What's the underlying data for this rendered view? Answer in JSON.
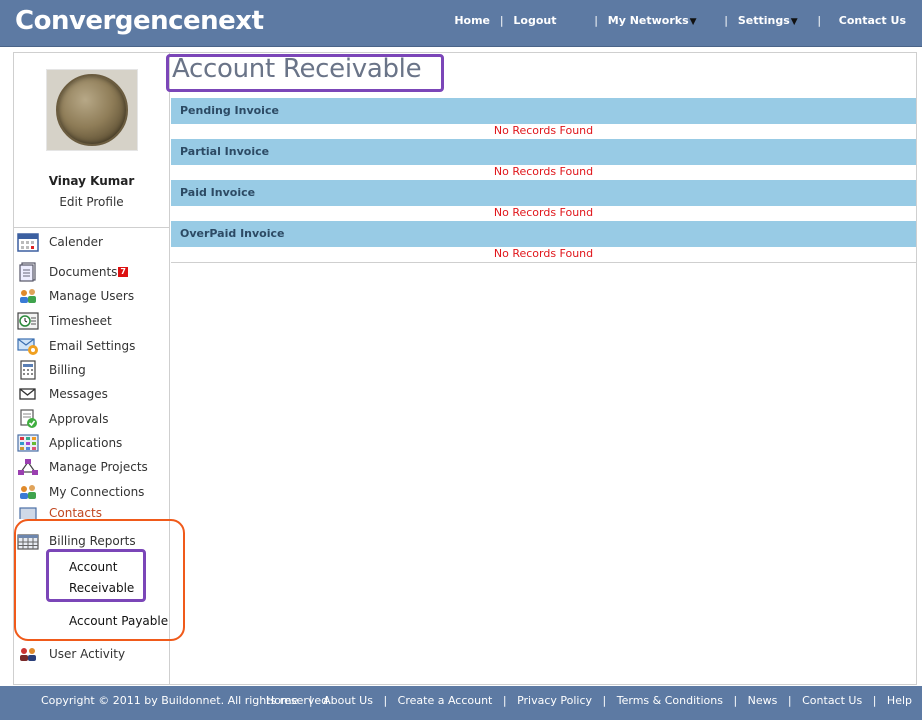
{
  "header": {
    "brand": "Convergencenext",
    "nav": {
      "home": "Home",
      "logout": "Logout",
      "my_networks": "My Networks",
      "settings": "Settings",
      "contact_us": "Contact Us",
      "sep": "|"
    }
  },
  "profile": {
    "name": "Vinay Kumar",
    "edit_label": "Edit Profile"
  },
  "sidebar": {
    "items": [
      {
        "label": "Calender",
        "icon": "calendar-icon"
      },
      {
        "label": "Documents",
        "icon": "documents-icon",
        "badge": "7"
      },
      {
        "label": "Manage Users",
        "icon": "users-icon"
      },
      {
        "label": "Timesheet",
        "icon": "timesheet-icon"
      },
      {
        "label": "Email Settings",
        "icon": "email-settings-icon"
      },
      {
        "label": "Billing",
        "icon": "billing-icon"
      },
      {
        "label": "Messages",
        "icon": "messages-icon"
      },
      {
        "label": "Approvals",
        "icon": "approvals-icon"
      },
      {
        "label": "Applications",
        "icon": "applications-icon"
      },
      {
        "label": "Manage Projects",
        "icon": "projects-icon"
      },
      {
        "label": "My Connections",
        "icon": "connections-icon"
      },
      {
        "label": "Contacts",
        "icon": "contacts-icon"
      },
      {
        "label": "Billing Reports",
        "icon": "billing-reports-icon"
      },
      {
        "label": "User Activity",
        "icon": "user-activity-icon"
      }
    ],
    "sub_items": {
      "account_receivable_line1": "Account",
      "account_receivable_line2": "Receivable",
      "account_payable": "Account Payable"
    }
  },
  "main": {
    "title": "Account Receivable",
    "sections": [
      {
        "heading": "Pending Invoice",
        "empty": "No Records Found"
      },
      {
        "heading": "Partial Invoice",
        "empty": "No Records Found"
      },
      {
        "heading": "Paid Invoice",
        "empty": "No Records Found"
      },
      {
        "heading": "OverPaid Invoice",
        "empty": "No Records Found"
      }
    ]
  },
  "footer": {
    "copyright": "Copyright © 2011 by Buildonnet. All rights reserved.",
    "links": {
      "home": "Home",
      "about": "About Us",
      "create": "Create a Account",
      "privacy": "Privacy Policy",
      "terms": "Terms & Conditions",
      "news": "News",
      "contact": "Contact Us",
      "help": "Help",
      "sep": "|"
    }
  },
  "colors": {
    "header_bg": "#5d7aa3",
    "section_header_bg": "#98cbe5",
    "empty_text": "#e0161b",
    "highlight_purple": "#7b46b8",
    "highlight_orange": "#f05a1a"
  }
}
